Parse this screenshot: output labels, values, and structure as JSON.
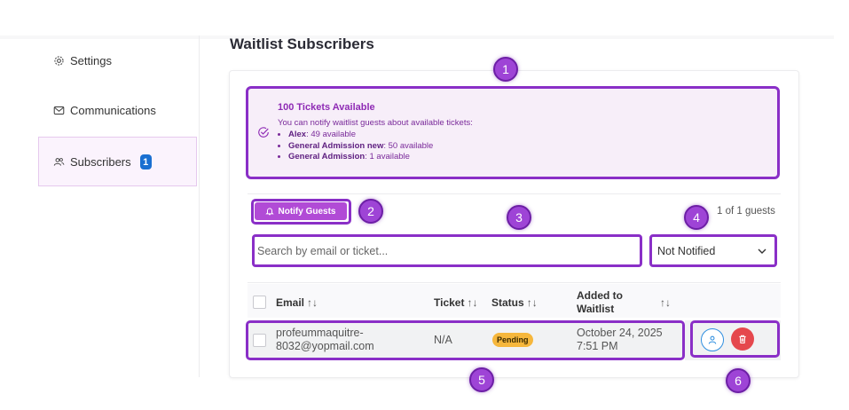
{
  "sidebar": {
    "items": [
      {
        "label": "Settings",
        "icon": "gear-icon"
      },
      {
        "label": "Communications",
        "icon": "mail-icon"
      },
      {
        "label": "Subscribers",
        "icon": "users-icon",
        "badge": "1",
        "active": true
      }
    ]
  },
  "page": {
    "title": "Waitlist Subscribers"
  },
  "alert": {
    "title": "100 Tickets Available",
    "description": "You can notify waitlist guests about available tickets:",
    "items": [
      {
        "name": "Alex",
        "detail": ": 49 available"
      },
      {
        "name": "General Admission new",
        "detail": ": 50 available"
      },
      {
        "name": "General Admission",
        "detail": ": 1 available"
      }
    ]
  },
  "toolbar": {
    "notify_label": "Notify Guests",
    "count_text": "1 of 1 guests"
  },
  "search": {
    "placeholder": "Search by email or ticket..."
  },
  "filter": {
    "selected": "Not Notified"
  },
  "table": {
    "headers": {
      "email": "Email",
      "ticket": "Ticket",
      "status": "Status",
      "added": "Added to Waitlist"
    },
    "sort_glyph": "↑↓",
    "rows": [
      {
        "email_line1": "profeummaquitre-",
        "email_line2": "8032@yopmail.com",
        "ticket": "N/A",
        "status": "Pending",
        "added_line1": "October 24, 2025",
        "added_line2": "7:51 PM"
      }
    ]
  },
  "callouts": [
    "1",
    "2",
    "3",
    "4",
    "5",
    "6"
  ],
  "colors": {
    "highlight": "#8a2fc7",
    "notify_button": "#b14bd6",
    "alert_bg": "#f7eef9",
    "badge": "#1a6fd1",
    "pending": "#f6b73c",
    "delete": "#e5484d",
    "user_action": "#2f8fe0"
  }
}
